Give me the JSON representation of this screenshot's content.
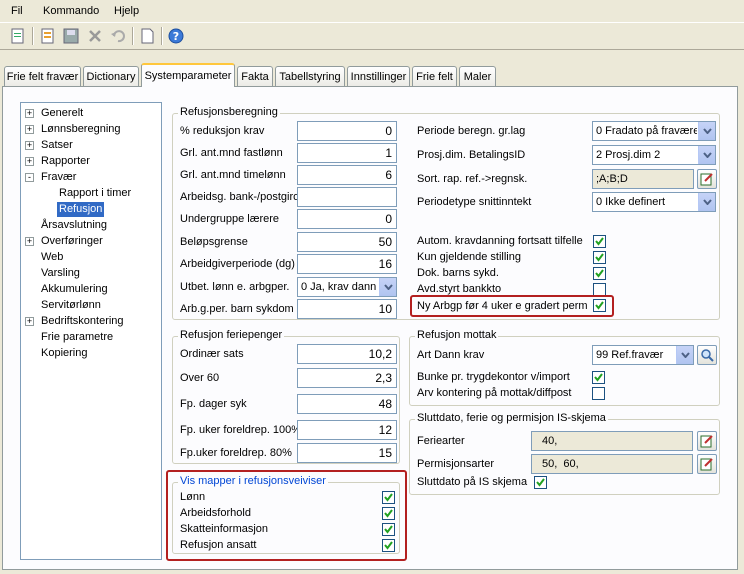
{
  "menu": [
    "Fil",
    "Kommando",
    "Hjelp"
  ],
  "toolbar_icons": [
    "new-document-icon",
    "open-icon",
    "save-icon",
    "delete-icon",
    "undo-icon",
    "blank-page-icon",
    "help-icon"
  ],
  "tabs": [
    {
      "label": "Frie felt fravær",
      "active": false
    },
    {
      "label": "Dictionary",
      "active": false
    },
    {
      "label": "Systemparameter",
      "active": true
    },
    {
      "label": "Fakta",
      "active": false
    },
    {
      "label": "Tabellstyring",
      "active": false
    },
    {
      "label": "Innstillinger",
      "active": false
    },
    {
      "label": "Frie felt",
      "active": false
    },
    {
      "label": "Maler",
      "active": false
    }
  ],
  "tree": [
    {
      "label": "Generelt",
      "expander": "+"
    },
    {
      "label": "Lønnsberegning",
      "expander": "+"
    },
    {
      "label": "Satser",
      "expander": "+"
    },
    {
      "label": "Rapporter",
      "expander": "+"
    },
    {
      "label": "Fravær",
      "expander": "-"
    },
    {
      "label": "Rapport i timer",
      "expander": ""
    },
    {
      "label": "Refusjon",
      "expander": "",
      "selected": true
    },
    {
      "label": "Årsavslutning",
      "expander": ""
    },
    {
      "label": "Overføringer",
      "expander": "+"
    },
    {
      "label": "Web",
      "expander": ""
    },
    {
      "label": "Varsling",
      "expander": ""
    },
    {
      "label": "Akkumulering",
      "expander": ""
    },
    {
      "label": "Servitørlønn",
      "expander": ""
    },
    {
      "label": "Bedriftskontering",
      "expander": "+"
    },
    {
      "label": "Frie parametre",
      "expander": ""
    },
    {
      "label": "Kopiering",
      "expander": ""
    }
  ],
  "refusjonsberegning": {
    "title": "Refusjonsberegning",
    "left": [
      {
        "label": "% reduksjon krav",
        "value": "0",
        "kind": "num"
      },
      {
        "label": "Grl. ant.mnd fastlønn",
        "value": "1",
        "kind": "num"
      },
      {
        "label": "Grl. ant.mnd timelønn",
        "value": "6",
        "kind": "num"
      },
      {
        "label": "Arbeidsg. bank-/postgiro",
        "value": "",
        "kind": "txt"
      },
      {
        "label": "Undergruppe lærere",
        "value": "0",
        "kind": "num"
      },
      {
        "label": "Beløpsgrense",
        "value": "50",
        "kind": "num"
      },
      {
        "label": "Arbeidgiverperiode (dg)",
        "value": "16",
        "kind": "num"
      },
      {
        "label": "Utbet. lønn e. arbgper.",
        "value": "0 Ja, krav dann",
        "kind": "combo"
      },
      {
        "label": "Arb.g.per. barn sykdom",
        "value": "10",
        "kind": "num"
      }
    ],
    "right_fields": [
      {
        "label": "Periode beregn. gr.lag",
        "value": "0 Fradato på fravære",
        "kind": "combo"
      },
      {
        "label": "Prosj.dim. BetalingsID",
        "value": "2 Prosj.dim 2",
        "kind": "combo"
      },
      {
        "label": "Sort. rap. ref.->regnsk.",
        "value": ";A;B;D",
        "kind": "ro"
      },
      {
        "label": "Periodetype snittinntekt",
        "value": "0 Ikke definert",
        "kind": "combo"
      }
    ],
    "checks": [
      {
        "label": "Autom. kravdanning fortsatt tilfelle",
        "checked": true
      },
      {
        "label": "Kun gjeldende stilling",
        "checked": true
      },
      {
        "label": "Dok. barns sykd.",
        "checked": true
      },
      {
        "label": "Avd.styrt bankkto",
        "checked": false
      },
      {
        "label": "Ny Arbgp før 4 uker e gradert perm",
        "checked": true
      }
    ]
  },
  "feriepenger": {
    "title": "Refusjon feriepenger",
    "fields": [
      {
        "label": "Ordinær sats",
        "value": "10,2"
      },
      {
        "label": "Over 60",
        "value": "2,3"
      },
      {
        "label": "Fp. dager syk",
        "value": "48"
      },
      {
        "label": "Fp. uker foreldrep. 100%",
        "value": "12"
      },
      {
        "label": "Fp.uker foreldrep. 80%",
        "value": "15"
      }
    ]
  },
  "mapper": {
    "title": "Vis mapper i refusjonsveiviser",
    "items": [
      {
        "label": "Lønn",
        "checked": true
      },
      {
        "label": "Arbeidsforhold",
        "checked": true
      },
      {
        "label": "Skatteinformasjon",
        "checked": true
      },
      {
        "label": "Refusjon ansatt",
        "checked": true
      }
    ]
  },
  "mottak": {
    "title": "Refusjon mottak",
    "art_label": "Art Dann krav",
    "art_value": "99 Ref.fravær",
    "checks": [
      {
        "label": "Bunke pr. trygdekontor v/import",
        "checked": true
      },
      {
        "label": "Arv kontering  på mottak/diffpost",
        "checked": false
      }
    ]
  },
  "sluttdato": {
    "title": "Sluttdato, ferie og permisjon IS-skjema",
    "fields": [
      {
        "label": "Feriearter",
        "value": "40,"
      },
      {
        "label": "Permisjonsarter",
        "value": "50,  60,"
      }
    ],
    "check": {
      "label": "Sluttdato på IS skjema",
      "checked": true
    }
  },
  "colors": {
    "accent": "#316ac5",
    "highlight": "#b32020",
    "check": "#21a121",
    "group_blue": "#0046d5"
  }
}
